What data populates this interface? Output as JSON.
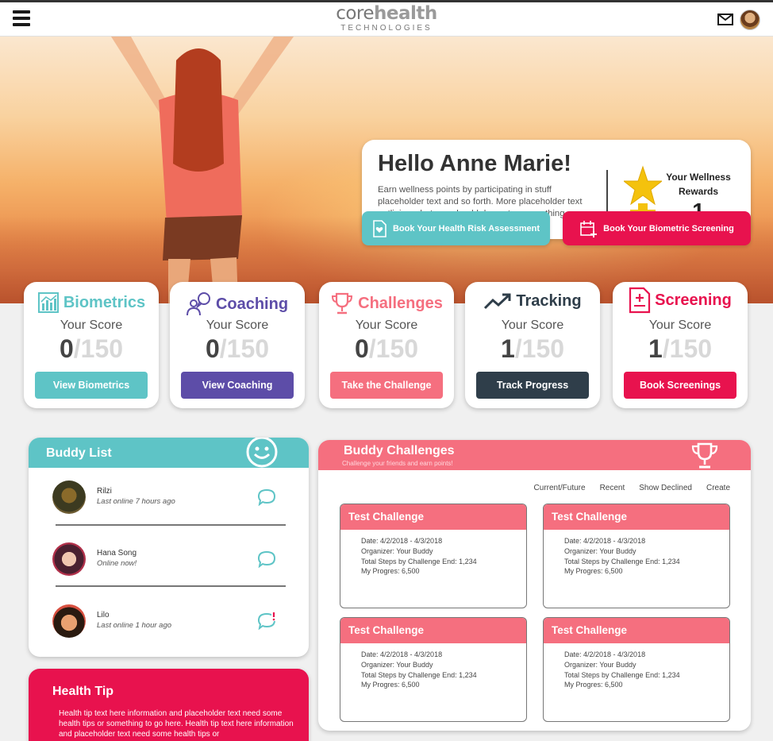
{
  "header": {
    "logo_core": "core",
    "logo_health": "health",
    "logo_sub": "TECHNOLOGIES",
    "menu_icon": "hamburger-menu-icon",
    "mail_icon": "envelope-icon"
  },
  "hero": {
    "greeting": "Hello Anne Marie!",
    "intro": "Earn wellness points by participating in stuff placeholder text and so forth. More placeholder text outlining what you should do next or something",
    "rewards_label": "Your Wellness Rewards",
    "rewards_count": "1",
    "btn_hra": "Book Your Health Risk Assessment",
    "btn_bio": "Book Your Biometric Screening"
  },
  "score_label": "Your Score",
  "score_max": "/150",
  "cards": [
    {
      "title": "Biometrics",
      "score": "0",
      "button": "View Biometrics",
      "color": "#5ec4c6",
      "icon": "bar-chart-icon"
    },
    {
      "title": "Coaching",
      "score": "0",
      "button": "View Coaching",
      "color": "#5d4da8",
      "icon": "people-chat-icon"
    },
    {
      "title": "Challenges",
      "score": "0",
      "button": "Take the Challenge",
      "color": "#f56f7f",
      "icon": "trophy-icon"
    },
    {
      "title": "Tracking",
      "score": "1",
      "button": "Track Progress",
      "color": "#2f3e4a",
      "icon": "trend-up-icon"
    },
    {
      "title": "Screening",
      "score": "1",
      "button": "Book Screenings",
      "color": "#e8124e",
      "icon": "clipboard-plus-icon"
    }
  ],
  "buddy_list": {
    "title": "Buddy List",
    "buddies": [
      {
        "name": "Rilzi",
        "status": "Last online 7 hours ago"
      },
      {
        "name": "Hana Song",
        "status": "Online now!"
      },
      {
        "name": "Lilo",
        "status": "Last online 1 hour ago"
      }
    ]
  },
  "health_tip": {
    "title": "Health Tip",
    "text": "Health tip text here information and placeholder text need some health tips or something to go here.  Health tip text here information and placeholder text need some health tips or"
  },
  "buddy_challenges": {
    "title": "Buddy Challenges",
    "subtitle": "Challenge your friends and earn points!",
    "filters": [
      "Current/Future",
      "Recent",
      "Show Declined",
      "Create"
    ],
    "challenges": [
      {
        "title": "Test Challenge",
        "date": "Date: 4/2/2018 - 4/3/2018",
        "organizer": "Organizer: Your Buddy",
        "steps": "Total Steps by Challenge End: 1,234",
        "progress": "My Progres: 6,500"
      },
      {
        "title": "Test Challenge",
        "date": "Date: 4/2/2018 - 4/3/2018",
        "organizer": "Organizer: Your Buddy",
        "steps": "Total Steps by Challenge End: 1,234",
        "progress": "My Progres: 6,500"
      },
      {
        "title": "Test Challenge",
        "date": "Date: 4/2/2018 - 4/3/2018",
        "organizer": "Organizer: Your Buddy",
        "steps": "Total Steps by Challenge End: 1,234",
        "progress": "My Progres: 6,500"
      },
      {
        "title": "Test Challenge",
        "date": "Date: 4/2/2018 - 4/3/2018",
        "organizer": "Organizer: Your Buddy",
        "steps": "Total Steps by Challenge End: 1,234",
        "progress": "My Progres: 6,500"
      }
    ]
  }
}
